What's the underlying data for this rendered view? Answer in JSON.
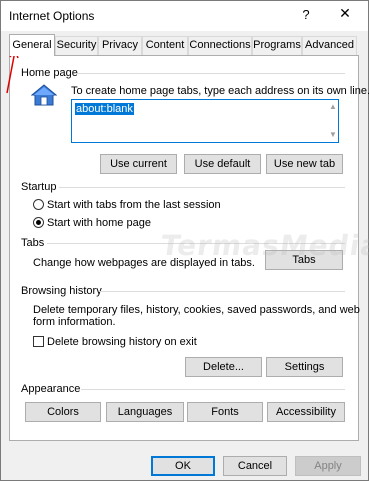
{
  "window": {
    "title": "Internet Options",
    "help_glyph": "?",
    "close_glyph": "✕"
  },
  "tabs": [
    {
      "label": "General",
      "active": true
    },
    {
      "label": "Security"
    },
    {
      "label": "Privacy"
    },
    {
      "label": "Content"
    },
    {
      "label": "Connections"
    },
    {
      "label": "Programs"
    },
    {
      "label": "Advanced"
    }
  ],
  "home_page": {
    "section_label": "Home page",
    "description": "To create home page tabs, type each address on its own line.",
    "address": "about:blank",
    "buttons": [
      "Use current",
      "Use default",
      "Use new tab"
    ]
  },
  "startup": {
    "section_label": "Startup",
    "options": [
      "Start with tabs from the last session",
      "Start with home page"
    ],
    "selected": 1
  },
  "tabs_section": {
    "section_label": "Tabs",
    "description": "Change how webpages are displayed in tabs.",
    "button": "Tabs"
  },
  "browsing_history": {
    "section_label": "Browsing history",
    "description_line1": "Delete temporary files, history, cookies, saved passwords, and web",
    "description_line2": "form information.",
    "checkbox_label": "Delete browsing history on exit",
    "checkbox_checked": false,
    "delete_button": "Delete...",
    "settings_button": "Settings"
  },
  "appearance": {
    "section_label": "Appearance",
    "buttons": [
      "Colors",
      "Languages",
      "Fonts",
      "Accessibility"
    ]
  },
  "footer": {
    "ok": "OK",
    "cancel": "Cancel",
    "apply": "Apply"
  },
  "watermark": "TermasMedia",
  "colors": {
    "accent": "#0078d7",
    "annotation": "#e00000"
  }
}
